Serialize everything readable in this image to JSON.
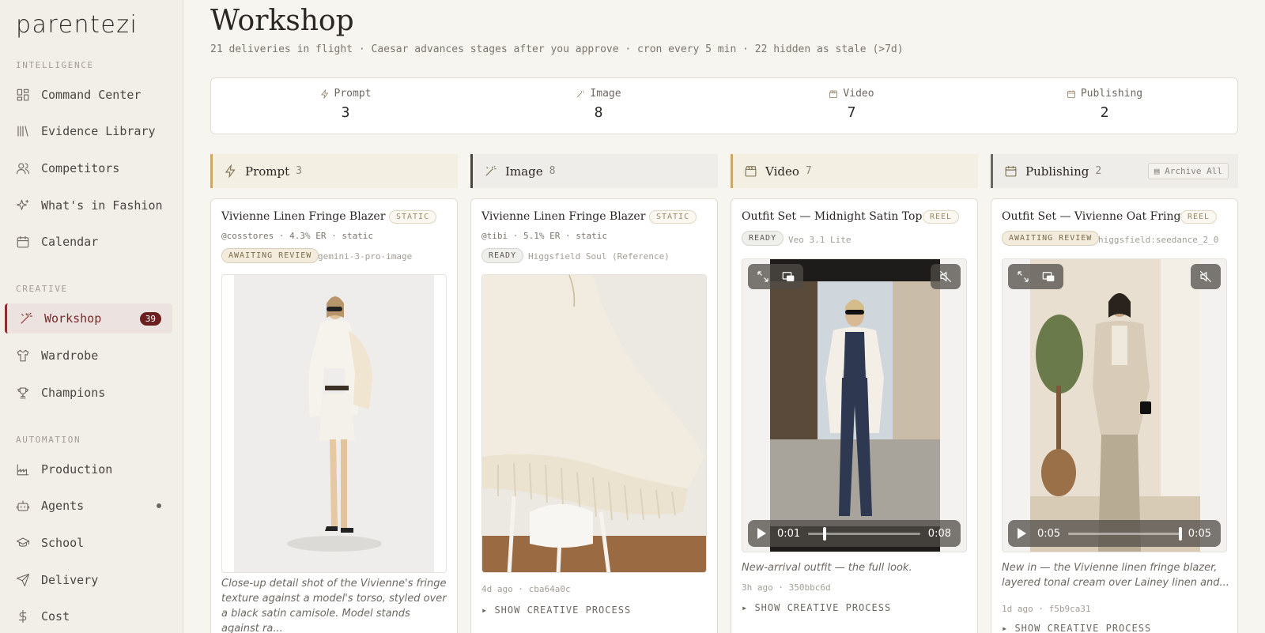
{
  "app": {
    "logo": "parentezi"
  },
  "sidebar": {
    "sections": {
      "intelligence": "INTELLIGENCE",
      "creative": "CREATIVE",
      "automation": "AUTOMATION"
    },
    "items": [
      {
        "label": "Command Center",
        "icon": "grid-icon"
      },
      {
        "label": "Evidence Library",
        "icon": "library-icon"
      },
      {
        "label": "Competitors",
        "icon": "users-icon"
      },
      {
        "label": "What's in Fashion",
        "icon": "sparkle-icon"
      },
      {
        "label": "Calendar",
        "icon": "calendar-icon"
      },
      {
        "label": "Workshop",
        "icon": "wand-icon",
        "badge": "39",
        "active": true
      },
      {
        "label": "Wardrobe",
        "icon": "shirt-icon"
      },
      {
        "label": "Champions",
        "icon": "trophy-icon"
      },
      {
        "label": "Production",
        "icon": "factory-icon"
      },
      {
        "label": "Agents",
        "icon": "bot-icon",
        "dot": true
      },
      {
        "label": "School",
        "icon": "graduation-icon"
      },
      {
        "label": "Delivery",
        "icon": "send-icon"
      },
      {
        "label": "Cost",
        "icon": "dollar-icon"
      }
    ]
  },
  "page": {
    "title": "Workshop",
    "subtitle": "21 deliveries in flight · Caesar advances stages after you approve · cron every 5 min · 22 hidden as stale (>7d)"
  },
  "stats": [
    {
      "label": "Prompt",
      "value": "3"
    },
    {
      "label": "Image",
      "value": "8"
    },
    {
      "label": "Video",
      "value": "7"
    },
    {
      "label": "Publishing",
      "value": "2"
    }
  ],
  "columns": [
    {
      "name": "Prompt",
      "count": "3",
      "color": "#c9a86a",
      "bg": "#f4efe3"
    },
    {
      "name": "Image",
      "count": "8",
      "color": "#4a4540",
      "bg": "#eeede9"
    },
    {
      "name": "Video",
      "count": "7",
      "color": "#c9a86a",
      "bg": "#f4efe3"
    },
    {
      "name": "Publishing",
      "count": "2",
      "color": "#6d6760",
      "bg": "#eeede9",
      "action": "Archive All"
    }
  ],
  "cards": [
    {
      "title": "Vivienne Linen Fringe Blazer - ...",
      "tag": "STATIC",
      "meta": "@cosstores · 4.3% ER · static",
      "status": "AWAITING REVIEW",
      "model": "gemini-3-pro-image",
      "description": "Close-up detail shot of the Vivienne's fringe texture against a model's torso, styled over a black satin camisole. Model stands against ra..."
    },
    {
      "title": "Vivienne Linen Fringe Blazer - ...",
      "tag": "STATIC",
      "meta": "@tibi · 5.1% ER · static",
      "status": "READY",
      "model": "Higgsfield Soul (Reference)",
      "footer": "4d ago · cba64a0c",
      "process": "▸ SHOW CREATIVE PROCESS"
    },
    {
      "title": "Outfit Set — Midnight Satin Top · ...",
      "tag": "REEL",
      "status": "READY",
      "model": "Veo 3.1 Lite",
      "time_current": "0:01",
      "time_total": "0:08",
      "progress": 0.15,
      "description": "New-arrival outfit — the full look.",
      "footer": "3h ago · 350bbc6d",
      "process": "▸ SHOW CREATIVE PROCESS"
    },
    {
      "title": "Outfit Set — Vivienne Oat Fringe ...",
      "tag": "REEL",
      "status": "AWAITING REVIEW",
      "model": "higgsfield:seedance_2_0",
      "time_current": "0:05",
      "time_total": "0:05",
      "progress": 1.0,
      "description": "New in — the Vivienne linen fringe blazer, layered tonal cream over Lainey linen and...",
      "footer": "1d ago · f5b9ca31",
      "process": "▸ SHOW CREATIVE PROCESS"
    }
  ]
}
